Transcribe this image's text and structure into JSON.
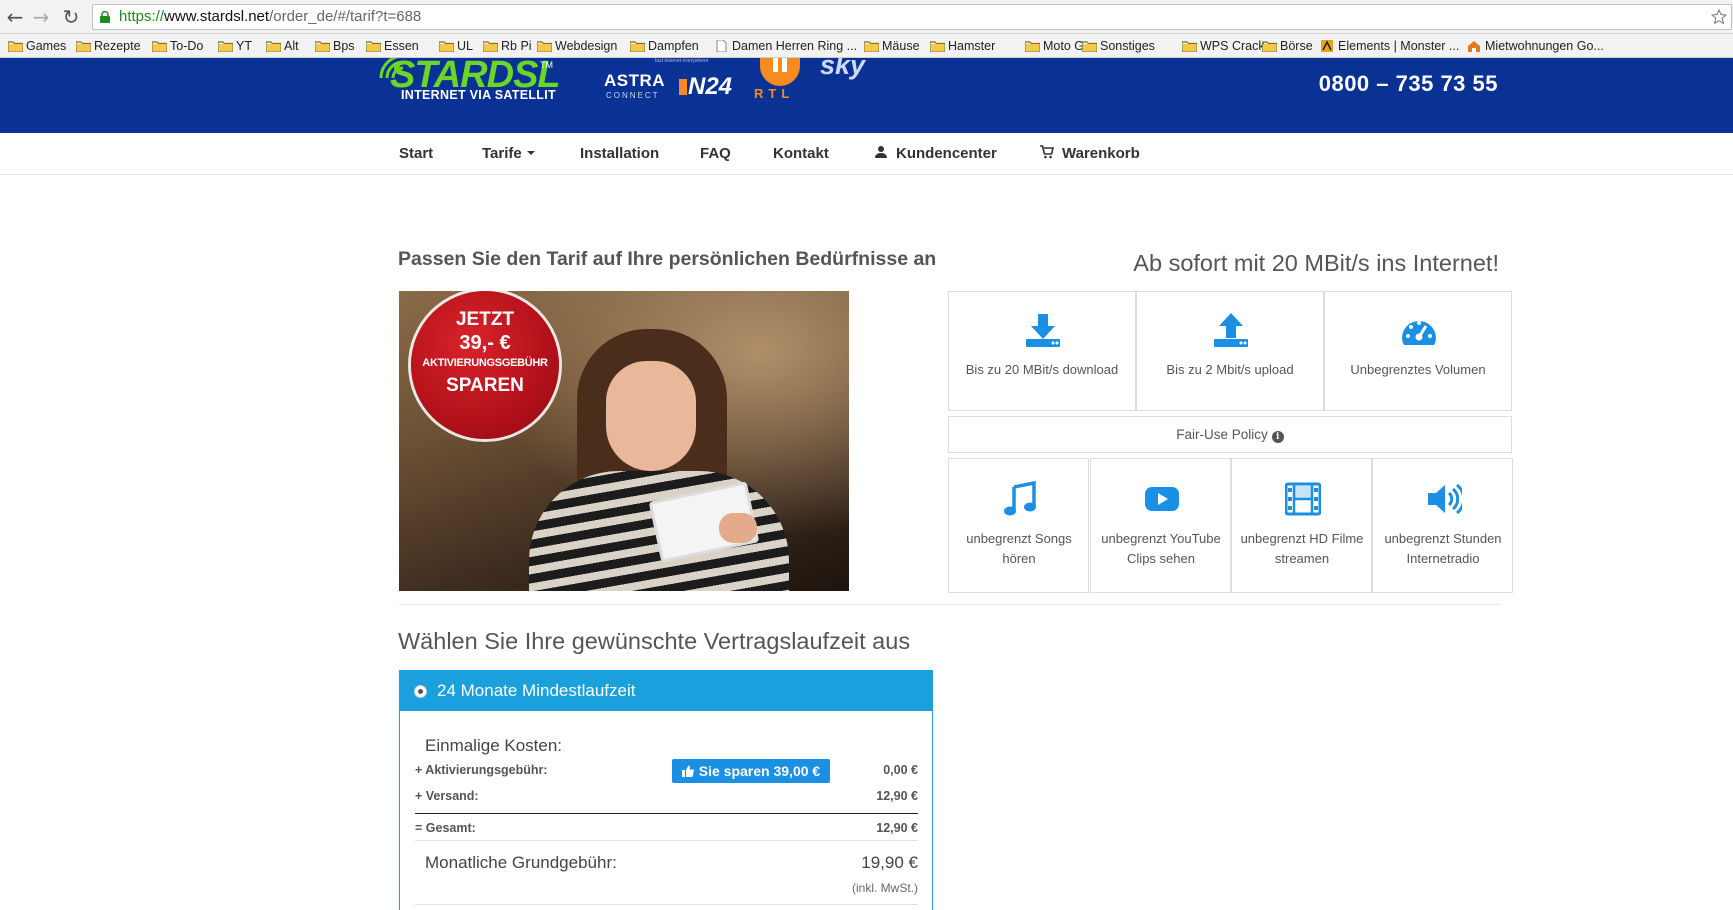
{
  "browser": {
    "url": {
      "scheme": "https://",
      "host": "www.stardsl.net",
      "path": "/order_de/#/tarif?t=688"
    },
    "bookmarks": [
      "Games",
      "Rezepte",
      "To-Do",
      "YT",
      "Alt",
      "Bps",
      "Essen",
      "UL",
      "Rb Pi",
      "Webdesign",
      "Dampfen",
      "Damen Herren Ring ...",
      "Mäuse",
      "Hamster",
      "Moto G",
      "Sonstiges",
      "WPS Crack",
      "Börse",
      "Elements | Monster ...",
      "Mietwohnungen Go..."
    ]
  },
  "header": {
    "logo_text": "STARDSL",
    "logo_tm": "TM",
    "logo_sub": "INTERNET VIA SATELLIT",
    "partner_astra": "ASTRA",
    "partner_astra_sub": "CONNECT",
    "partner_n24": "N24",
    "partner_rtl": "RTL",
    "partner_sky": "sky",
    "partner_tiny": "fast internet everywhere",
    "hotline": "0800 – 735 73 55",
    "colors": {
      "bar": "#0a3194",
      "logo": "#6cd626",
      "accent": "#f68b1f"
    }
  },
  "nav": {
    "items": [
      "Start",
      "Tarife",
      "Installation",
      "FAQ",
      "Kontakt",
      "Kundencenter",
      "Warenkorb"
    ]
  },
  "content": {
    "intro": "Passen Sie den Tarif auf Ihre persönlichen Bedürfnisse an",
    "promo_title": "Ab sofort mit 20 MBit/s ins Internet!",
    "badge": {
      "line1": "JETZT",
      "line2": "39,- €",
      "line3": "AKTIVIERUNGSGEBÜHR",
      "line4": "SPAREN"
    },
    "features_top": [
      {
        "icon": "download-icon",
        "text": "Bis zu 20 MBit/s download"
      },
      {
        "icon": "upload-icon",
        "text": "Bis zu 2 Mbit/s upload"
      },
      {
        "icon": "dashboard-icon",
        "text": "Unbegrenztes Volumen"
      }
    ],
    "fair_use": "Fair-Use Policy",
    "features_bottom": [
      {
        "icon": "music-icon",
        "text": "unbegrenzt Songs hören"
      },
      {
        "icon": "youtube-icon",
        "text": "unbegrenzt YouTube Clips sehen"
      },
      {
        "icon": "film-icon",
        "text": "unbegrenzt HD Filme streamen"
      },
      {
        "icon": "speaker-icon",
        "text": "unbegrenzt Stunden Internetradio"
      }
    ],
    "choose_title": "Wählen Sie Ihre gewünschte Vertragslaufzeit aus",
    "accent_color": "#1aa0dc"
  },
  "tarif": {
    "title": "24 Monate Mindestlaufzeit",
    "once_label": "Einmalige Kosten:",
    "save_badge": "Sie sparen 39,00 €",
    "rows": [
      {
        "label": "+ Aktivierungsgebühr:",
        "value": "0,00 €"
      },
      {
        "label": "+ Versand:",
        "value": "12,90 €"
      },
      {
        "label": "= Gesamt:",
        "value": "12,90 €"
      }
    ],
    "monthly_label": "Monatliche Grundgebühr:",
    "monthly_value": "19,90 €",
    "tax_note": "(inkl. MwSt.)"
  }
}
